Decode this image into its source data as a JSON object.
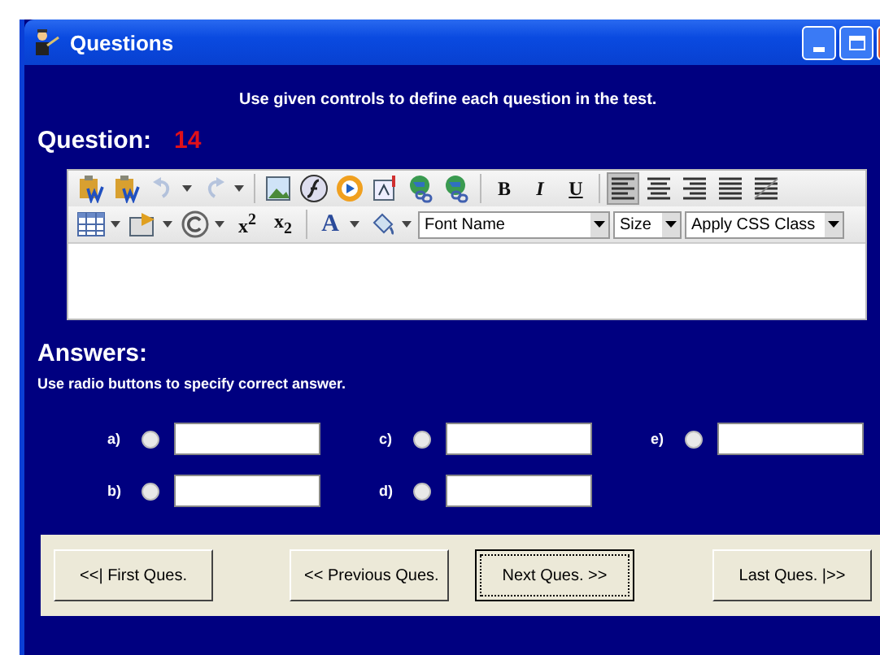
{
  "window": {
    "title": "Questions"
  },
  "instruction": "Use given controls to define each question in the test.",
  "question": {
    "label": "Question:",
    "number": "14"
  },
  "editor": {
    "rows": [
      [
        {
          "kind": "paste-word",
          "disabled": false,
          "selected": false
        },
        {
          "kind": "paste-word",
          "disabled": false,
          "selected": false
        },
        {
          "kind": "undo",
          "disabled": true,
          "selected": false,
          "caret": true
        },
        {
          "kind": "redo",
          "disabled": true,
          "selected": false,
          "caret": true
        },
        {
          "kind": "separator"
        },
        {
          "kind": "image",
          "disabled": false,
          "selected": false
        },
        {
          "kind": "flash",
          "disabled": false,
          "selected": false
        },
        {
          "kind": "media",
          "disabled": false,
          "selected": false
        },
        {
          "kind": "document",
          "disabled": false,
          "selected": false
        },
        {
          "kind": "link",
          "disabled": false,
          "selected": false
        },
        {
          "kind": "unlink",
          "disabled": false,
          "selected": false
        },
        {
          "kind": "separator"
        },
        {
          "kind": "bold",
          "label": "B",
          "disabled": false,
          "selected": false
        },
        {
          "kind": "italic",
          "label": "I",
          "disabled": false,
          "selected": false
        },
        {
          "kind": "underline",
          "label": "U",
          "disabled": false,
          "selected": false
        },
        {
          "kind": "separator"
        },
        {
          "kind": "align-left",
          "disabled": false,
          "selected": true
        },
        {
          "kind": "align-center",
          "disabled": false,
          "selected": false
        },
        {
          "kind": "align-right",
          "disabled": false,
          "selected": false
        },
        {
          "kind": "align-justify",
          "disabled": false,
          "selected": false
        },
        {
          "kind": "align-full",
          "disabled": false,
          "selected": false
        }
      ],
      [
        {
          "kind": "table",
          "disabled": false,
          "selected": false,
          "caret": true
        },
        {
          "kind": "properties",
          "disabled": false,
          "selected": false,
          "caret": true
        },
        {
          "kind": "copyright",
          "disabled": false,
          "selected": false,
          "caret": true
        },
        {
          "kind": "superscript",
          "label": "x$^{2}$",
          "disabled": false,
          "selected": false
        },
        {
          "kind": "subscript",
          "label": "x$_{2}$",
          "disabled": false,
          "selected": false
        },
        {
          "kind": "separator"
        },
        {
          "kind": "font-color",
          "label": "A",
          "disabled": false,
          "selected": false,
          "caret": true
        },
        {
          "kind": "paint",
          "disabled": false,
          "selected": false,
          "caret": true
        },
        {
          "kind": "select",
          "label": "Font Name"
        },
        {
          "kind": "select",
          "label": "Size"
        },
        {
          "kind": "select",
          "label": "Apply CSS Class"
        }
      ]
    ]
  },
  "answers": {
    "heading": "Answers:",
    "hint": "Use radio buttons to specify correct answer.",
    "options": [
      {
        "label": "a)",
        "selected": false
      },
      {
        "label": "b)",
        "selected": false
      },
      {
        "label": "c)",
        "selected": false
      },
      {
        "label": "d)",
        "selected": false
      },
      {
        "label": "e)",
        "selected": false
      }
    ]
  },
  "buttons": [
    {
      "label": "<<| First Ques.",
      "focused": false
    },
    {
      "label": "<< Previous Ques.",
      "focused": false
    },
    {
      "label": "Next Ques. >>",
      "focused": true
    },
    {
      "label": "Last Ques. |>>",
      "focused": false
    }
  ]
}
